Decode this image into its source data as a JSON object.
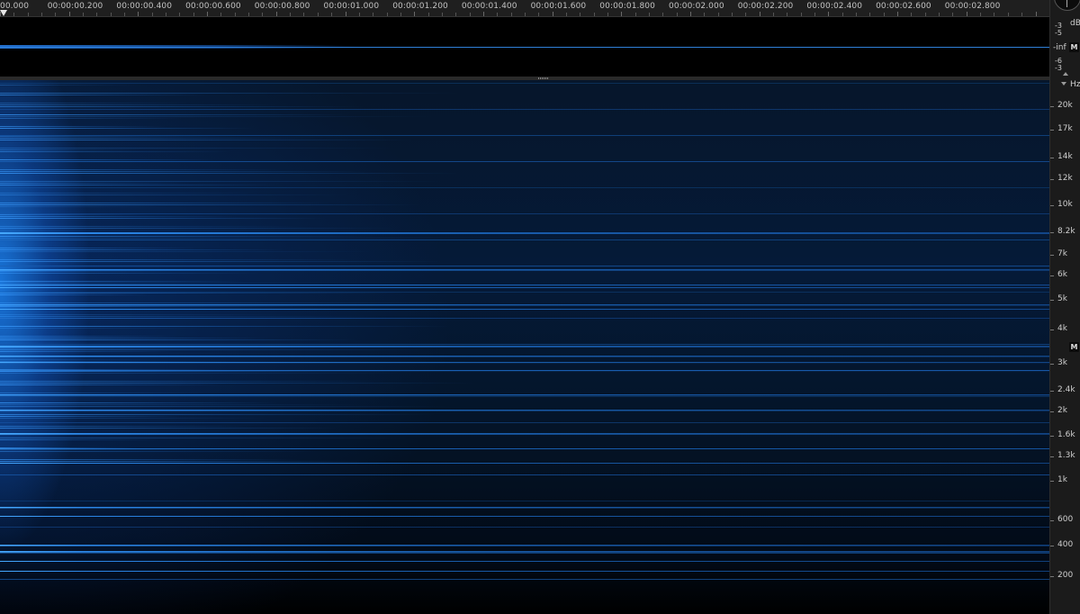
{
  "ruler": {
    "labels": [
      "00.000",
      "00:00:00.200",
      "00:00:00.400",
      "00:00:00.600",
      "00:00:00.800",
      "00:00:01.000",
      "00:00:01.200",
      "00:00:01.400",
      "00:00:01.600",
      "00:00:01.800",
      "00:00:02.000",
      "00:00:02.200",
      "00:00:02.400",
      "00:00:02.600",
      "00:00:02.800"
    ]
  },
  "waveform_axis": {
    "unit": "dB",
    "labels": [
      "-3",
      "-5",
      "-inf",
      "-6",
      "-3"
    ],
    "m_label": "M"
  },
  "spectrogram_axis": {
    "unit": "Hz",
    "labels": [
      "20k",
      "17k",
      "14k",
      "12k",
      "10k",
      "8.2k",
      "7k",
      "6k",
      "5k",
      "4k",
      "3k",
      "2.4k",
      "2k",
      "1.6k",
      "1.3k",
      "1k",
      "600",
      "400",
      "200"
    ],
    "m_label": "M"
  },
  "colors": {
    "accent": "#2f7fd8",
    "spectrum_bright": "#3fa0ff",
    "background": "#000000",
    "panel": "#1b1b1b"
  }
}
